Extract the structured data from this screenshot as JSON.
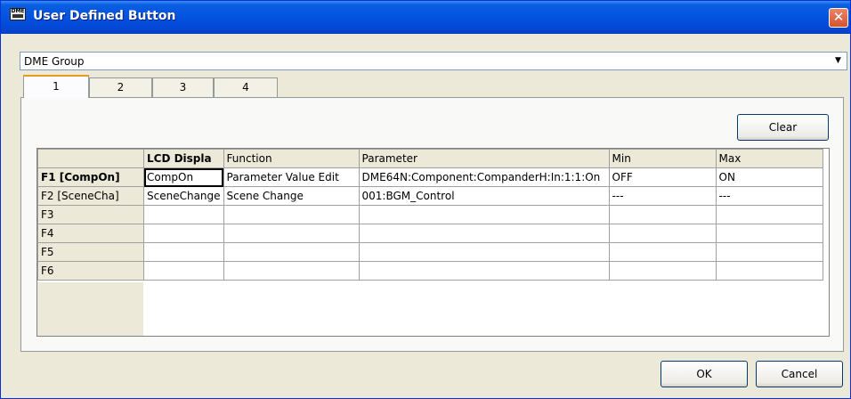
{
  "window": {
    "title": "User Defined Button",
    "close_glyph": "✕"
  },
  "group_select": {
    "value": "DME Group",
    "arrow_glyph": "▼"
  },
  "tabs": [
    {
      "label": "1",
      "active": true
    },
    {
      "label": "2",
      "active": false
    },
    {
      "label": "3",
      "active": false
    },
    {
      "label": "4",
      "active": false
    }
  ],
  "buttons": {
    "clear": "Clear",
    "ok": "OK",
    "cancel": "Cancel"
  },
  "grid": {
    "columns": [
      "LCD Displa",
      "Function",
      "Parameter",
      "Min",
      "Max"
    ],
    "rows": [
      {
        "label": "F1 [CompOn]",
        "cells": [
          "CompOn",
          "Parameter Value Edit",
          "DME64N:Component:CompanderH:In:1:1:On",
          "OFF",
          "ON"
        ]
      },
      {
        "label": "F2 [SceneCha]",
        "cells": [
          "SceneChange",
          "Scene Change",
          "001:BGM_Control",
          "---",
          "---"
        ]
      },
      {
        "label": "F3",
        "cells": [
          "",
          "",
          "",
          "",
          ""
        ]
      },
      {
        "label": "F4",
        "cells": [
          "",
          "",
          "",
          "",
          ""
        ]
      },
      {
        "label": "F5",
        "cells": [
          "",
          "",
          "",
          "",
          ""
        ]
      },
      {
        "label": "F6",
        "cells": [
          "",
          "",
          "",
          "",
          ""
        ]
      }
    ]
  },
  "icons": {
    "app_icon": "dme-app-icon",
    "close": "close-icon",
    "dropdown": "chevron-down-icon"
  },
  "colors": {
    "titlebar": "#0352e0",
    "dialog_bg": "#ece9d8",
    "close_btn": "#d4532e",
    "active_tab_accent": "#e69b1f"
  }
}
